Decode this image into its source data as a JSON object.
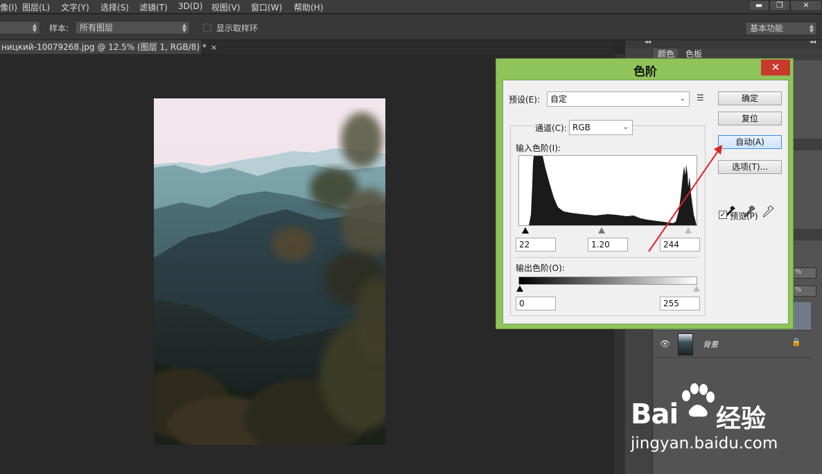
{
  "menu": {
    "items": [
      "像(I)",
      "图层(L)",
      "文字(Y)",
      "选择(S)",
      "滤镜(T)",
      "3D(D)",
      "视图(V)",
      "窗口(W)",
      "帮助(H)"
    ],
    "minimize": "▬",
    "restore": "❐",
    "close": "✕"
  },
  "options": {
    "sample_label": "样本:",
    "sample_value": "所有图层",
    "show_ring_label": "显示取样环",
    "workspace": "基本功能"
  },
  "document": {
    "tab_title": "ницкий-10079268.jpg @ 12.5% (图层 1, RGB/8) *",
    "tab_close": "×"
  },
  "panels": {
    "tab_color": "颜色",
    "tab_swatches": "色板",
    "collapse": "◂◂",
    "layer_name": "背景",
    "percent": "%"
  },
  "dialog": {
    "title": "色阶",
    "close": "✕",
    "preset_label": "预设(E):",
    "preset_value": "自定",
    "channel_label": "通道(C):",
    "channel_value": "RGB",
    "input_levels_label": "输入色阶(I):",
    "input_black": "22",
    "input_gamma": "1.20",
    "input_white": "244",
    "output_levels_label": "输出色阶(O):",
    "output_black": "0",
    "output_white": "255",
    "btn_ok": "确定",
    "btn_reset": "复位",
    "btn_auto": "自动(A)",
    "btn_options": "选项(T)...",
    "preview_label": "预览(P)",
    "preview_checked": true
  },
  "watermark": {
    "brand": "Bai",
    "brand_suffix": "经验",
    "url": "jingyan.baidu.com"
  },
  "colors": {
    "dialog_frame": "#8fc45a",
    "close_red": "#c8392d",
    "annotation_arrow": "#e02020"
  }
}
